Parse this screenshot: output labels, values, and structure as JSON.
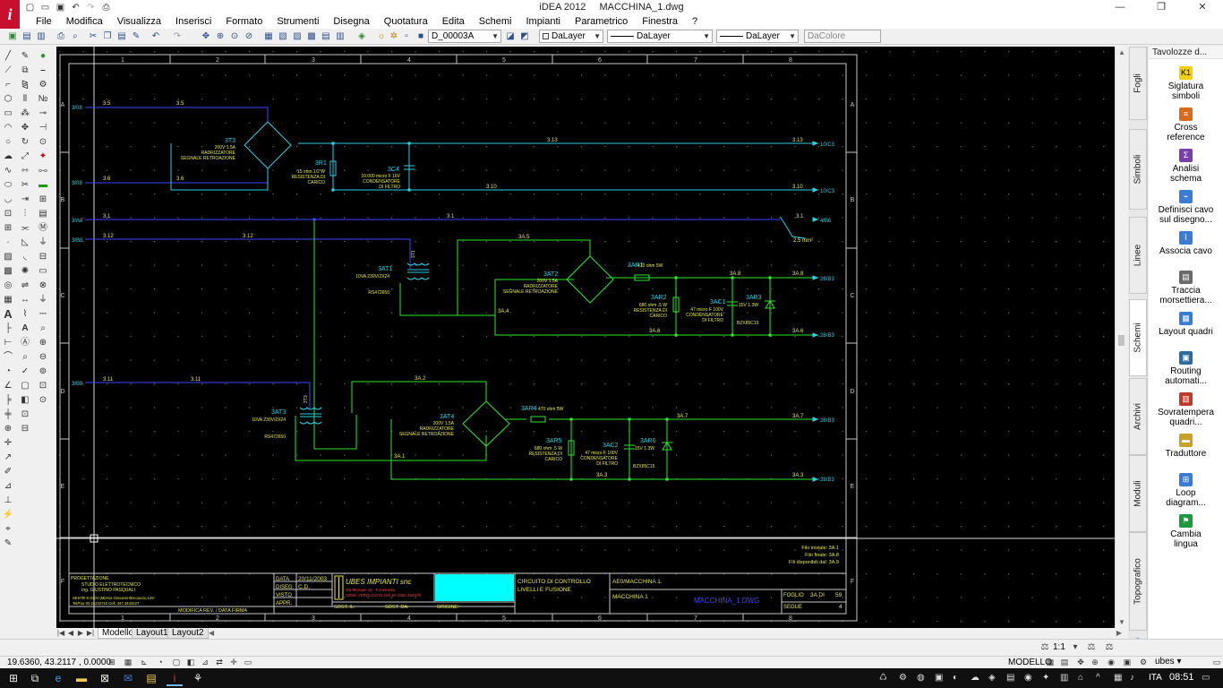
{
  "app": {
    "logo_letter": "i",
    "name": "iDEA 2012",
    "document": "MACCHINA_1.dwg"
  },
  "window_controls": {
    "minimize": "—",
    "maximize": "❐",
    "close": "✕"
  },
  "menu": [
    "File",
    "Modifica",
    "Visualizza",
    "Inserisci",
    "Formato",
    "Strumenti",
    "Disegna",
    "Quotatura",
    "Edita",
    "Schemi",
    "Impianti",
    "Parametrico",
    "Finestra",
    "?"
  ],
  "toolbar": {
    "layer_combo": "D_00003A",
    "color_combo": "DaLayer",
    "linetype_combo": "DaLayer",
    "lineweight_combo": "DaLayer",
    "plotstyle_combo": "DaColore"
  },
  "right_dock": {
    "tabs": [
      "Fogli",
      "Simboli",
      "Linee",
      "Schemi",
      "Archivi",
      "Moduli",
      "Topografico"
    ],
    "active_tab": "Schemi",
    "palette_title": "Tavolozze d...",
    "items": [
      {
        "label1": "Siglatura",
        "label2": "simboli",
        "icon": "K1"
      },
      {
        "label1": "Cross",
        "label2": "reference",
        "icon": "≡"
      },
      {
        "label1": "Analisi",
        "label2": "schema",
        "icon": "Σ"
      },
      {
        "label1": "Definisci cavo",
        "label2": "sul disegno...",
        "icon": "⌁"
      },
      {
        "label1": "Associa cavo",
        "label2": "",
        "icon": "⌇"
      },
      {
        "label1": "Traccia",
        "label2": "morsettiera...",
        "icon": "▤"
      },
      {
        "label1": "Layout quadri",
        "label2": "",
        "icon": "▦"
      },
      {
        "label1": "Routing",
        "label2": "automati...",
        "icon": "▣"
      },
      {
        "label1": "Sovratempera",
        "label2": "quadri...",
        "icon": "▥"
      },
      {
        "label1": "Traduttore",
        "label2": "",
        "icon": "▬"
      },
      {
        "label1": "Loop",
        "label2": "diagram...",
        "icon": "⊞"
      },
      {
        "label1": "Cambia",
        "label2": "lingua",
        "icon": "⚑"
      }
    ]
  },
  "layout_tabs": [
    "Modello",
    "Layout1",
    "Layout2"
  ],
  "status": {
    "coordinates": "19.6360, 43.2117 , 0.0000",
    "scale": "1:1",
    "mode": "MODELLO",
    "profile": "ubes"
  },
  "taskbar": {
    "language": "ITA",
    "time": "08:51"
  },
  "drawing": {
    "columns": [
      "1",
      "2",
      "3",
      "4",
      "5",
      "6",
      "7",
      "8"
    ],
    "rows": [
      "A",
      "B",
      "C",
      "D",
      "E",
      "F"
    ],
    "left_refs": [
      "3/08",
      "3/08",
      "3/A8",
      "3/B8",
      "3/B8"
    ],
    "right_refs": [
      "10/C3",
      "10/C3",
      "4/B6",
      "28/B3",
      "28/B3",
      "28/B3",
      "28/B3"
    ],
    "wire_labels": {
      "w35": "3.5",
      "w36": "3.6",
      "w313": "3.13",
      "w310": "3.10",
      "w31": "3.1",
      "w312": "3.12",
      "w3a5": "3A.5",
      "w3a4": "3A.4",
      "w3a6": "3A.6",
      "w3a8": "3A.8",
      "w311": "3.11",
      "w3a2": "3A.2",
      "w3a7": "3A.7",
      "w3a1": "3A.1",
      "w3a3": "3A.3",
      "wire_size": "2.5 mm²"
    },
    "components": {
      "bridge1_tag": "3T3",
      "bridge1_spec": "200V 1.5A",
      "bridge1_desc1": "RADRIZZATORE",
      "bridge1_desc2": "SEGNALE RETROAZIONE",
      "r1_tag": "3R1",
      "r1_spec": "15 ohm  1/2 W",
      "r1_desc1": "RESISTENZA DI",
      "r1_desc2": "CARICO",
      "c4_tag": "3C4",
      "c4_spec": "10.000 micro F 16V",
      "c4_desc1": "CONDENSATORE",
      "c4_desc2": "DI FILTRO",
      "t1_tag": "3AT1",
      "t1_spec": "10VA 230V/2X24",
      "t1_code": "RS472650",
      "t1_core": "3T1",
      "bridge2_tag": "3AT2",
      "bridge2_spec": "200V 1.5A",
      "bridge2_desc1": "RADRIZZATORE",
      "bridge2_desc2": "SEGNALE RETROAZIONE",
      "ar1_tag": "3AR1",
      "ar1_spec": "470 ohm 5W",
      "ar2_tag": "3AR2",
      "ar2_spec": "680 ohm .5 W",
      "ar2_desc1": "RESISTENZA DI",
      "ar2_desc2": "CARICO",
      "ac1_tag": "3AC1",
      "ac1_spec": "47 micro F 100V",
      "ac1_desc1": "CONDENSATORE",
      "ac1_desc2": "DI FILTRO",
      "ar3_tag": "3AR3",
      "ar3_spec": "15V 1.3W",
      "ar3_code": "BZX85C15",
      "t3_tag": "3AT3",
      "t3_spec": "10VA 230V/2X24",
      "t3_code": "RS472650",
      "t3_core": "3T3",
      "bridge3_tag": "3AT4",
      "bridge3_spec": "200V 1.5A",
      "bridge3_desc1": "RADRIZZATORE",
      "bridge3_desc2": "SEGNALE RETROAZIONE",
      "ar4_tag": "3AR4",
      "ar4_spec": "470 ohm 5W",
      "ar5_tag": "3AR5",
      "ar5_spec": "680 ohm .5 W",
      "ar5_desc1": "RESISTENZA DI",
      "ar5_desc2": "CARICO",
      "ac2_tag": "3AC2",
      "ac2_spec": "47 micro F 100V",
      "ac2_desc1": "CONDENSATORE",
      "ac2_desc2": "DI FILTRO",
      "ar6_tag": "3AR6",
      "ar6_spec": "15V 1.3W",
      "ar6_code": "BZX85C15"
    },
    "notes": {
      "n1": "Filo iniziale:  3A.1",
      "n2": "Filo finale:  3A.8",
      "n3": "Fili disponibili dal:  3A.9"
    },
    "title_block": {
      "designer_l1": "PROGETTAZIONE",
      "designer_l2": "STUDIO ELETTROTECNICO",
      "designer_l3": "Ing. GIUSTINO PASQUALI",
      "designer_l4": "SESTO S.GIOV.(Mi)-via Giovanni Boccaccio,125",
      "designer_l5": "Tel/Fax 02.24222710  Cell. 347.3443227",
      "data_lbl": "DATA",
      "data_val": "20/11/2003",
      "disegn_lbl": "DISEG.",
      "disegn_val": "C.D.",
      "visto_lbl": "VISTO",
      "appr_lbl": "APPR.",
      "modifica": "MODIFICA",
      "rev": "REV. / DATA FIRMA",
      "company": "UBES IMPIANTI snc",
      "company_l2": "Via Montale 10 - Fontanella",
      "company_l3": "20080 VERDUGGIO (MI) tel 0362 469378",
      "sost_il": "SOST. IL:",
      "sost_da": "SOST. DA:",
      "origine": "ORIGINE:",
      "desc1": "CIRCUITO DI CONTROLLO",
      "desc2": "LIVELLI E FUSIONE",
      "project": "AE0/MACCHINA 1.",
      "machine": "MACCHINA 1",
      "file": "MACCHINA_1.DWG",
      "foglio_lbl": "FOGLIO",
      "foglio_val": "3A DI",
      "foglio_tot": "59",
      "segue_lbl": "SEGUE",
      "segue_val": "4"
    }
  }
}
